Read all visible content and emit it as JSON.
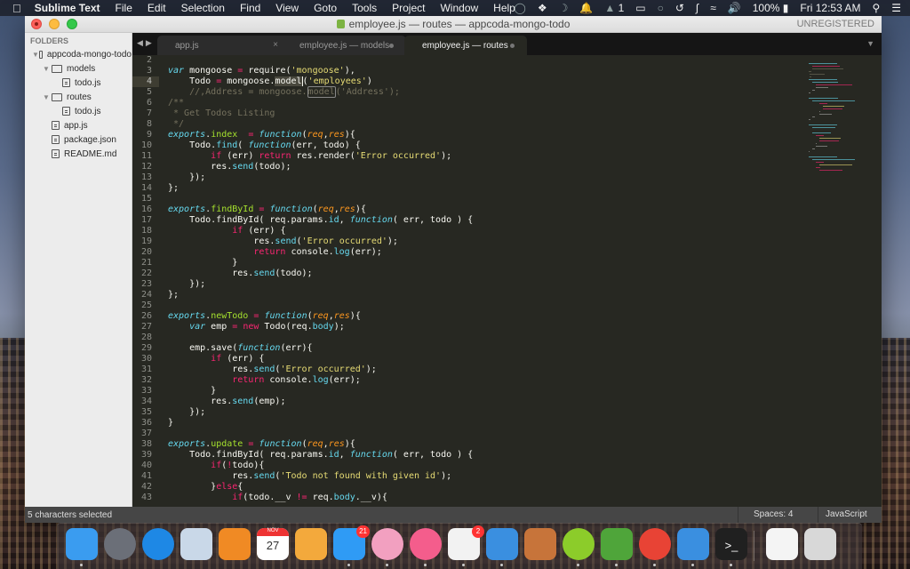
{
  "menubar": {
    "app_name": "Sublime Text",
    "items": [
      "File",
      "Edit",
      "Selection",
      "Find",
      "View",
      "Goto",
      "Tools",
      "Project",
      "Window",
      "Help"
    ],
    "status": {
      "notification_count": "1",
      "battery": "100%",
      "clock": "Fri 12:53 AM"
    }
  },
  "window": {
    "title": "employee.js — routes — appcoda-mongo-todo",
    "license": "UNREGISTERED"
  },
  "sidebar": {
    "header": "FOLDERS",
    "tree": [
      {
        "label": "appcoda-mongo-todo",
        "type": "folder",
        "depth": 0,
        "expanded": true
      },
      {
        "label": "models",
        "type": "folder",
        "depth": 1,
        "expanded": true
      },
      {
        "label": "todo.js",
        "type": "file",
        "depth": 2
      },
      {
        "label": "routes",
        "type": "folder",
        "depth": 1,
        "expanded": true
      },
      {
        "label": "todo.js",
        "type": "file",
        "depth": 2
      },
      {
        "label": "app.js",
        "type": "file",
        "depth": 1
      },
      {
        "label": "package.json",
        "type": "file",
        "depth": 1
      },
      {
        "label": "README.md",
        "type": "file",
        "depth": 1
      }
    ]
  },
  "tabs": [
    {
      "label": "app.js",
      "state": "close",
      "active": false
    },
    {
      "label": "employee.js — models",
      "state": "dirty",
      "active": false
    },
    {
      "label": "employee.js — routes",
      "state": "dirty",
      "active": true
    }
  ],
  "editor": {
    "current_line": 4,
    "lines": [
      {
        "n": 2,
        "html": ""
      },
      {
        "n": 3,
        "html": "<span class='fn'>var</span> mongoose <span class='kw'>=</span> require(<span class='st'>'mongoose'</span>),"
      },
      {
        "n": 4,
        "html": "    Todo <span class='kw'>=</span> mongoose.<span class='sel caret'>model</span>(<span class='st'>'employees'</span>)"
      },
      {
        "n": 5,
        "html": "    <span class='cm'>//,Address = mongoose.<span class='cur-sel'>model</span>('Address');</span>"
      },
      {
        "n": 6,
        "html": "<span class='cm'>/**</span>"
      },
      {
        "n": 7,
        "html": "<span class='cm'> * Get Todos Listing</span>"
      },
      {
        "n": 8,
        "html": "<span class='cm'> */</span>"
      },
      {
        "n": 9,
        "html": "<span class='fn'>exports</span>.<span class='pr'>index</span>  <span class='kw'>=</span> <span class='fn'>function</span>(<span class='pa'>req</span>,<span class='pa'>res</span>){"
      },
      {
        "n": 10,
        "html": "    Todo.<span class='me'>find</span>( <span class='fn'>function</span>(err, todo) {"
      },
      {
        "n": 11,
        "html": "        <span class='kw'>if</span> (err) <span class='kw'>return</span> res.render(<span class='st'>'Error occurred'</span>);"
      },
      {
        "n": 12,
        "html": "        res.<span class='me'>send</span>(todo);"
      },
      {
        "n": 13,
        "html": "    });"
      },
      {
        "n": 14,
        "html": "};"
      },
      {
        "n": 15,
        "html": ""
      },
      {
        "n": 16,
        "html": "<span class='fn'>exports</span>.<span class='pr'>findById</span> <span class='kw'>=</span> <span class='fn'>function</span>(<span class='pa'>req</span>,<span class='pa'>res</span>){"
      },
      {
        "n": 17,
        "html": "    Todo.findById( req.params.<span class='me'>id</span>, <span class='fn'>function</span>( err, todo ) {"
      },
      {
        "n": 18,
        "html": "            <span class='kw'>if</span> (err) {"
      },
      {
        "n": 19,
        "html": "                res.<span class='me'>send</span>(<span class='st'>'Error occurred'</span>);"
      },
      {
        "n": 20,
        "html": "                <span class='kw'>return</span> console.<span class='me'>log</span>(err);"
      },
      {
        "n": 21,
        "html": "            }"
      },
      {
        "n": 22,
        "html": "            res.<span class='me'>send</span>(todo);"
      },
      {
        "n": 23,
        "html": "    });"
      },
      {
        "n": 24,
        "html": "};"
      },
      {
        "n": 25,
        "html": ""
      },
      {
        "n": 26,
        "html": "<span class='fn'>exports</span>.<span class='pr'>newTodo</span> <span class='kw'>=</span> <span class='fn'>function</span>(<span class='pa'>req</span>,<span class='pa'>res</span>){"
      },
      {
        "n": 27,
        "html": "    <span class='fn'>var</span> emp <span class='kw'>=</span> <span class='kw'>new</span> Todo(req.<span class='me'>body</span>);"
      },
      {
        "n": 28,
        "html": ""
      },
      {
        "n": 29,
        "html": "    emp.save(<span class='fn'>function</span>(err){"
      },
      {
        "n": 30,
        "html": "        <span class='kw'>if</span> (err) {"
      },
      {
        "n": 31,
        "html": "            res.<span class='me'>send</span>(<span class='st'>'Error occurred'</span>);"
      },
      {
        "n": 32,
        "html": "            <span class='kw'>return</span> console.<span class='me'>log</span>(err);"
      },
      {
        "n": 33,
        "html": "        }"
      },
      {
        "n": 34,
        "html": "        res.<span class='me'>send</span>(emp);"
      },
      {
        "n": 35,
        "html": "    });"
      },
      {
        "n": 36,
        "html": "}"
      },
      {
        "n": 37,
        "html": ""
      },
      {
        "n": 38,
        "html": "<span class='fn'>exports</span>.<span class='pr'>update</span> <span class='kw'>=</span> <span class='fn'>function</span>(<span class='pa'>req</span>,<span class='pa'>res</span>){"
      },
      {
        "n": 39,
        "html": "    Todo.findById( req.params.<span class='me'>id</span>, <span class='fn'>function</span>( err, todo ) {"
      },
      {
        "n": 40,
        "html": "        <span class='kw'>if</span>(<span class='kw'>!</span>todo){"
      },
      {
        "n": 41,
        "html": "            res.<span class='me'>send</span>(<span class='st'>'Todo not found with given id'</span>);"
      },
      {
        "n": 42,
        "html": "        }<span class='kw'>else</span>{"
      },
      {
        "n": 43,
        "html": "            <span class='kw'>if</span>(todo.__v <span class='kw'>!=</span> req.<span class='me'>body</span>.__v){"
      }
    ]
  },
  "statusbar": {
    "selection": "5 characters selected",
    "indent": "Spaces: 4",
    "syntax": "JavaScript"
  },
  "dock": {
    "apps": [
      {
        "name": "Finder",
        "color": "#3a9cf0",
        "running": true
      },
      {
        "name": "Launchpad",
        "color": "#6b6f78",
        "running": false
      },
      {
        "name": "Safari",
        "color": "#1e88e5",
        "running": false
      },
      {
        "name": "Mail",
        "color": "#c9d8e8",
        "running": false
      },
      {
        "name": "Pages",
        "color": "#f08a24",
        "running": false
      },
      {
        "name": "Calendar",
        "color": "#ffffff",
        "running": false,
        "label": "27",
        "month": "NOV"
      },
      {
        "name": "Keynote",
        "color": "#f3a93c",
        "running": false
      },
      {
        "name": "Messages",
        "color": "#2f9bf5",
        "running": true,
        "badge": "21"
      },
      {
        "name": "Photos",
        "color": "#f2a0c0",
        "running": true
      },
      {
        "name": "iTunes",
        "color": "#f45d8c",
        "running": true
      },
      {
        "name": "Slack",
        "color": "#f2f2f2",
        "running": true,
        "badge": "2"
      },
      {
        "name": "Xcode",
        "color": "#3a8fe0",
        "running": true
      },
      {
        "name": "Preview",
        "color": "#c7743a",
        "running": false
      },
      {
        "name": "Lime",
        "color": "#8ccc2a",
        "running": true
      },
      {
        "name": "Coda",
        "color": "#4fa53a",
        "running": true
      },
      {
        "name": "Chrome",
        "color": "#e84335",
        "running": true
      },
      {
        "name": "Simulator",
        "color": "#3a8fe0",
        "running": true
      },
      {
        "name": "Terminal",
        "color": "#202020",
        "running": true,
        "label": ">_"
      },
      {
        "name": "Downloads",
        "color": "#f4f4f4",
        "running": false
      },
      {
        "name": "Trash",
        "color": "#d8d8d8",
        "running": false
      }
    ]
  }
}
